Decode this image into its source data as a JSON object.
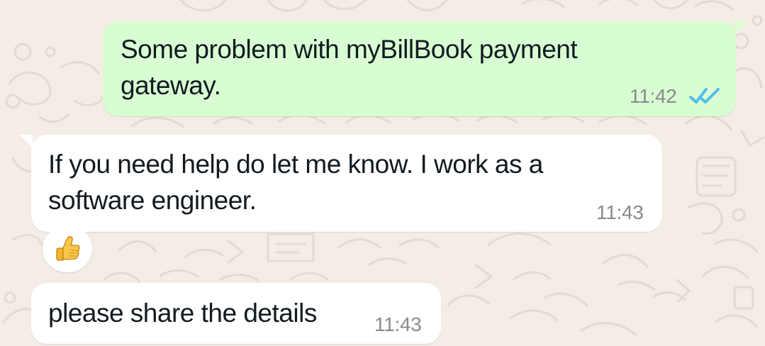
{
  "chat": {
    "messages": [
      {
        "direction": "outgoing",
        "text": "Some problem with myBillBook payment gateway.",
        "time": "11:42",
        "status": "read",
        "status_icon": "double-check-icon",
        "status_color": "#53bdeb"
      },
      {
        "direction": "incoming",
        "text": "If you need help do let me know. I work as a software engineer.",
        "time": "11:43",
        "reaction": {
          "emoji": "👍",
          "icon": "thumbs-up-icon"
        }
      },
      {
        "direction": "incoming",
        "text": "please share the details",
        "time": "11:43"
      }
    ]
  },
  "colors": {
    "wallpaper": "#f3ede5",
    "outgoing_bubble": "#d9fdd3",
    "incoming_bubble": "#ffffff",
    "text": "#111b21",
    "meta_text": "#8a8a8a"
  }
}
